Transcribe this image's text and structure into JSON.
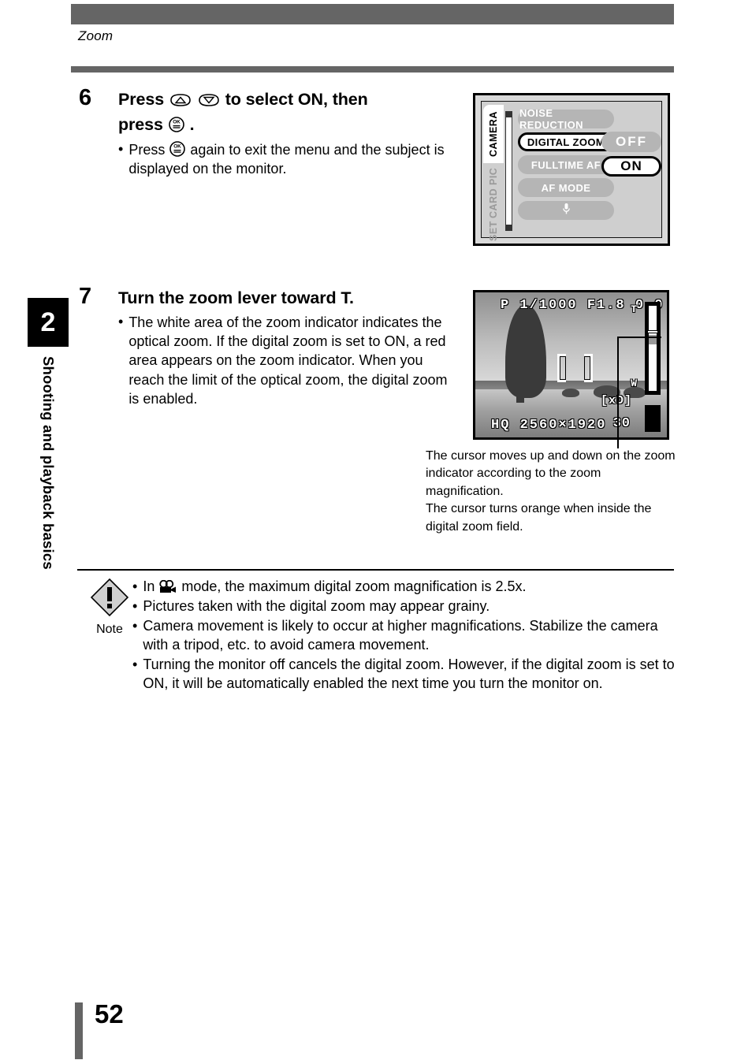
{
  "header": {
    "running_head": "Zoom"
  },
  "sidebar": {
    "chapter_number": "2",
    "chapter_title": "Shooting and playback basics"
  },
  "footer": {
    "page_number": "52"
  },
  "steps": [
    {
      "number": "6",
      "heading_part1": "Press",
      "heading_part2": "to select ON, then",
      "heading_part3": "press",
      "heading_part4": ".",
      "bullet_part1": "Press",
      "bullet_part2": "again to exit the menu and the subject is displayed on the monitor."
    },
    {
      "number": "7",
      "heading": "Turn the zoom lever toward T.",
      "bullet": "The white area of the zoom indicator indicates the optical zoom. If the digital zoom is set to ON, a red area appears on the zoom indicator. When you reach the limit of the optical zoom, the digital zoom is enabled."
    }
  ],
  "menu_figure": {
    "tabs": [
      {
        "label": "CAMERA",
        "active": true
      },
      {
        "label": "PIC",
        "active": false
      },
      {
        "label": "CARD",
        "active": false
      },
      {
        "label": "SET",
        "active": false
      }
    ],
    "items": [
      {
        "label": "NOISE REDUCTION",
        "selected": false
      },
      {
        "label": "DIGITAL ZOOM",
        "selected": true
      },
      {
        "label": "FULLTIME AF",
        "selected": false
      },
      {
        "label": "AF MODE",
        "selected": false
      },
      {
        "label": "ƪ",
        "selected": false,
        "icon": "microphone-icon"
      }
    ],
    "options": [
      {
        "label": "OFF",
        "selected": false
      },
      {
        "label": "ON",
        "selected": true
      }
    ]
  },
  "lcd_figure": {
    "osd_top": "P 1/1000 F1.8  0.0",
    "osd_bottom": "HQ 2560×1920",
    "osd_card": "[xD]",
    "osd_count": "30",
    "zoom_tele_label": "T",
    "zoom_wide_label": "W"
  },
  "caption": {
    "line1": "The cursor moves up and down on the zoom indicator according to the zoom magnification.",
    "line2": "The cursor turns orange when inside the digital zoom field."
  },
  "note": {
    "label": "Note",
    "items": [
      {
        "prefix": "In",
        "suffix": "mode, the maximum digital zoom magnification is 2.5x.",
        "has_icon": true
      },
      {
        "text": "Pictures taken with the digital zoom may appear grainy."
      },
      {
        "text": "Camera movement is likely to occur at higher magnifications. Stabilize the camera with a tripod, etc. to avoid camera movement."
      },
      {
        "text": "Turning the monitor off cancels the digital zoom. However, if the digital zoom is set to ON, it will be automatically enabled the next time you turn the monitor on."
      }
    ]
  },
  "colors": {
    "bar_gray": "#656565",
    "menu_bg": "#cfcfcf",
    "menu_item_gray": "#b5b5b5"
  }
}
